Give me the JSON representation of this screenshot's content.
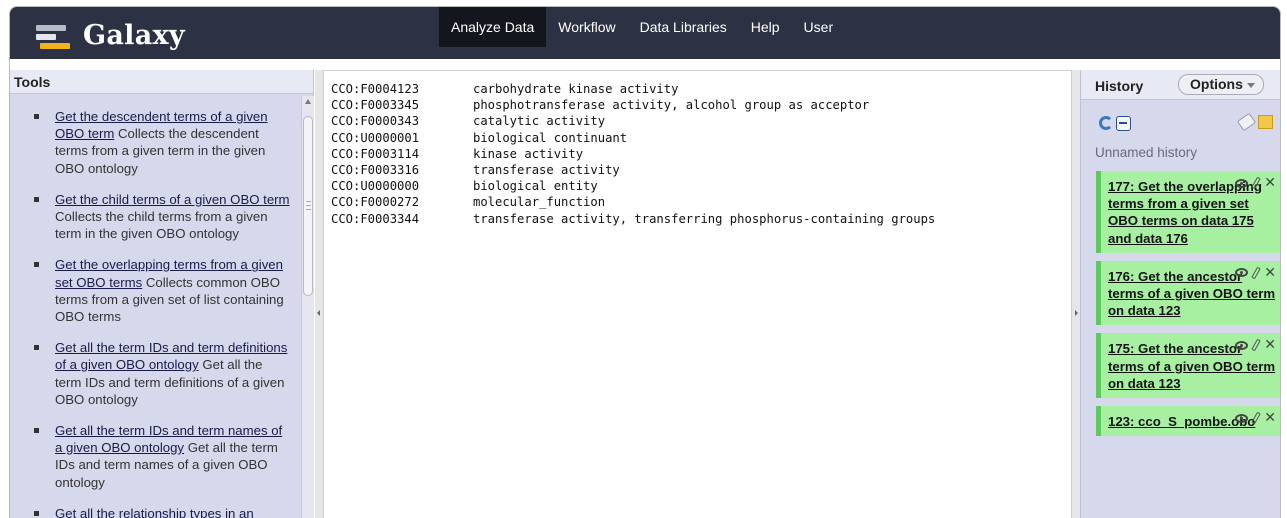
{
  "app": {
    "title": "Galaxy"
  },
  "nav": {
    "tabs": [
      {
        "label": "Analyze Data",
        "active": true
      },
      {
        "label": "Workflow",
        "active": false
      },
      {
        "label": "Data Libraries",
        "active": false
      },
      {
        "label": "Help",
        "active": false
      },
      {
        "label": "User",
        "active": false
      }
    ]
  },
  "tools": {
    "header": "Tools",
    "items": [
      {
        "link": "Get the descendent terms of a given OBO term",
        "desc": " Collects the descendent terms from a given term in the given OBO ontology"
      },
      {
        "link": "Get the child terms of a given OBO term",
        "desc": " Collects the child terms from a given term in the given OBO ontology"
      },
      {
        "link": "Get the overlapping terms from a given set OBO terms",
        "desc": " Collects common OBO terms from a given set of list containing OBO terms"
      },
      {
        "link": "Get all the term IDs and term definitions of a given OBO ontology",
        "desc": " Get all the term IDs and term definitions of a given OBO ontology"
      },
      {
        "link": "Get all the term IDs and term names of a given OBO ontology",
        "desc": " Get all the term IDs and term names of a given OBO ontology"
      },
      {
        "link": "Get all the relationship types in an",
        "desc": ""
      }
    ]
  },
  "center": {
    "rows": [
      {
        "id": "CCO:F0004123",
        "name": "carbohydrate kinase activity"
      },
      {
        "id": "CCO:F0003345",
        "name": "phosphotransferase activity, alcohol group as acceptor"
      },
      {
        "id": "CCO:F0000343",
        "name": "catalytic activity"
      },
      {
        "id": "CCO:U0000001",
        "name": "biological continuant"
      },
      {
        "id": "CCO:F0003114",
        "name": "kinase activity"
      },
      {
        "id": "CCO:F0003316",
        "name": "transferase activity"
      },
      {
        "id": "CCO:U0000000",
        "name": "biological entity"
      },
      {
        "id": "CCO:F0000272",
        "name": "molecular_function"
      },
      {
        "id": "CCO:F0003344",
        "name": "transferase activity, transferring phosphorus-containing groups"
      }
    ]
  },
  "history": {
    "title": "History",
    "options_label": "Options",
    "name": "Unnamed history",
    "icons": [
      "refresh-icon",
      "collapse-icon",
      "tag-icon",
      "annotation-icon"
    ],
    "datasets": [
      {
        "title": "177: Get the overlapping terms from a given set OBO terms on data 175 and data 176",
        "state_color": "#a7f0a1"
      },
      {
        "title": "176: Get the ancestor terms of a given OBO term on data 123",
        "state_color": "#a7f0a1"
      },
      {
        "title": "175: Get the ancestor terms of a given OBO term on data 123",
        "state_color": "#a7f0a1"
      },
      {
        "title": "123: cco_S_pombe.obo",
        "state_color": "#a7f0a1"
      }
    ],
    "dataset_icons": [
      "eye-icon",
      "pencil-icon",
      "delete-icon"
    ]
  },
  "colors": {
    "masthead": "#2c3143",
    "active_tab": "#14161d",
    "panel_bg": "#d6d8ec",
    "dataset_ok": "#a7f0a1",
    "logo_accent": "#f0b21f"
  }
}
